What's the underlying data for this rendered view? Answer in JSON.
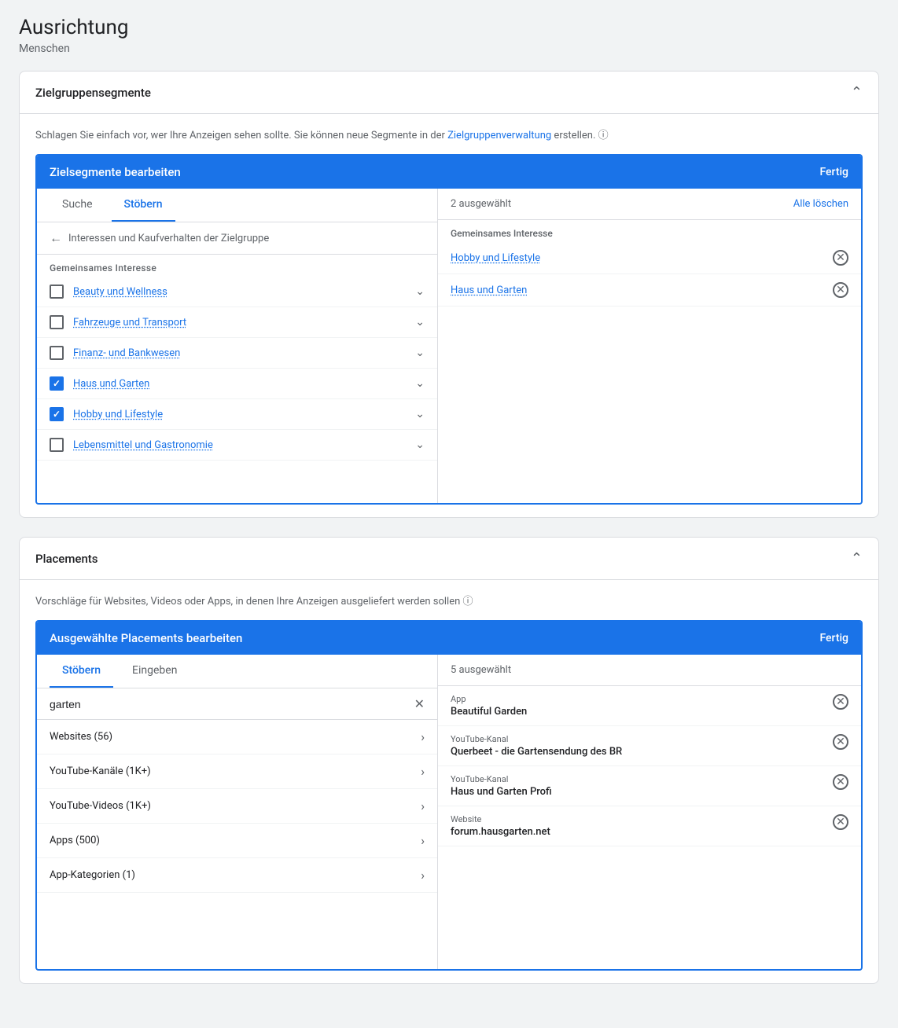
{
  "page": {
    "title": "Ausrichtung",
    "subtitle": "Menschen"
  },
  "zielgruppe": {
    "section_title": "Zielgruppensegmente",
    "description": "Schlagen Sie einfach vor, wer Ihre Anzeigen sehen sollte.  Sie können neue Segmente in der",
    "link_text": "Zielgruppenverwaltung",
    "description_end": "erstellen.",
    "edit_panel_title": "Zielsegmente bearbeiten",
    "done_label": "Fertig",
    "tab_search": "Suche",
    "tab_browse": "Stöbern",
    "selected_count": "2 ausgewählt",
    "clear_all": "Alle löschen",
    "breadcrumb": "Interessen und Kaufverhalten der Zielgruppe",
    "gemeinsames_interesse_label": "Gemeinsames Interesse",
    "right_section_label": "Gemeinsames Interesse",
    "browse_items": [
      {
        "id": "beauty",
        "label": "Beauty und Wellness",
        "checked": false
      },
      {
        "id": "fahrzeuge",
        "label": "Fahrzeuge und Transport",
        "checked": false
      },
      {
        "id": "finanz",
        "label": "Finanz- und Bankwesen",
        "checked": false
      },
      {
        "id": "haus",
        "label": "Haus und Garten",
        "checked": true
      },
      {
        "id": "hobby",
        "label": "Hobby und Lifestyle",
        "checked": true
      },
      {
        "id": "lebensmittel",
        "label": "Lebensmittel und Gastronomie",
        "checked": false
      }
    ],
    "selected_items": [
      {
        "id": "hobby",
        "label": "Hobby und Lifestyle"
      },
      {
        "id": "haus",
        "label": "Haus und Garten"
      }
    ]
  },
  "placements": {
    "section_title": "Placements",
    "description": "Vorschläge für Websites, Videos oder Apps, in denen Ihre Anzeigen ausgeliefert werden sollen",
    "edit_panel_title": "Ausgewählte Placements bearbeiten",
    "done_label": "Fertig",
    "tab_browse": "Stöbern",
    "tab_enter": "Eingeben",
    "selected_count": "5 ausgewählt",
    "search_value": "garten",
    "browse_items": [
      {
        "id": "websites",
        "label": "Websites (56)"
      },
      {
        "id": "youtube-kanaele",
        "label": "YouTube-Kanäle (1K+)"
      },
      {
        "id": "youtube-videos",
        "label": "YouTube-Videos (1K+)"
      },
      {
        "id": "apps",
        "label": "Apps (500)"
      },
      {
        "id": "app-kategorien",
        "label": "App-Kategorien (1)"
      }
    ],
    "selected_items": [
      {
        "id": "beautiful-garden",
        "type": "App",
        "name": "Beautiful Garden"
      },
      {
        "id": "querbeet",
        "type": "YouTube-Kanal",
        "name": "Querbeet - die Gartensendung des BR"
      },
      {
        "id": "haus-garten-profi",
        "type": "YouTube-Kanal",
        "name": "Haus und Garten Profi"
      },
      {
        "id": "forum-hausgarten",
        "type": "Website",
        "name": "forum.hausgarten.net"
      }
    ]
  }
}
